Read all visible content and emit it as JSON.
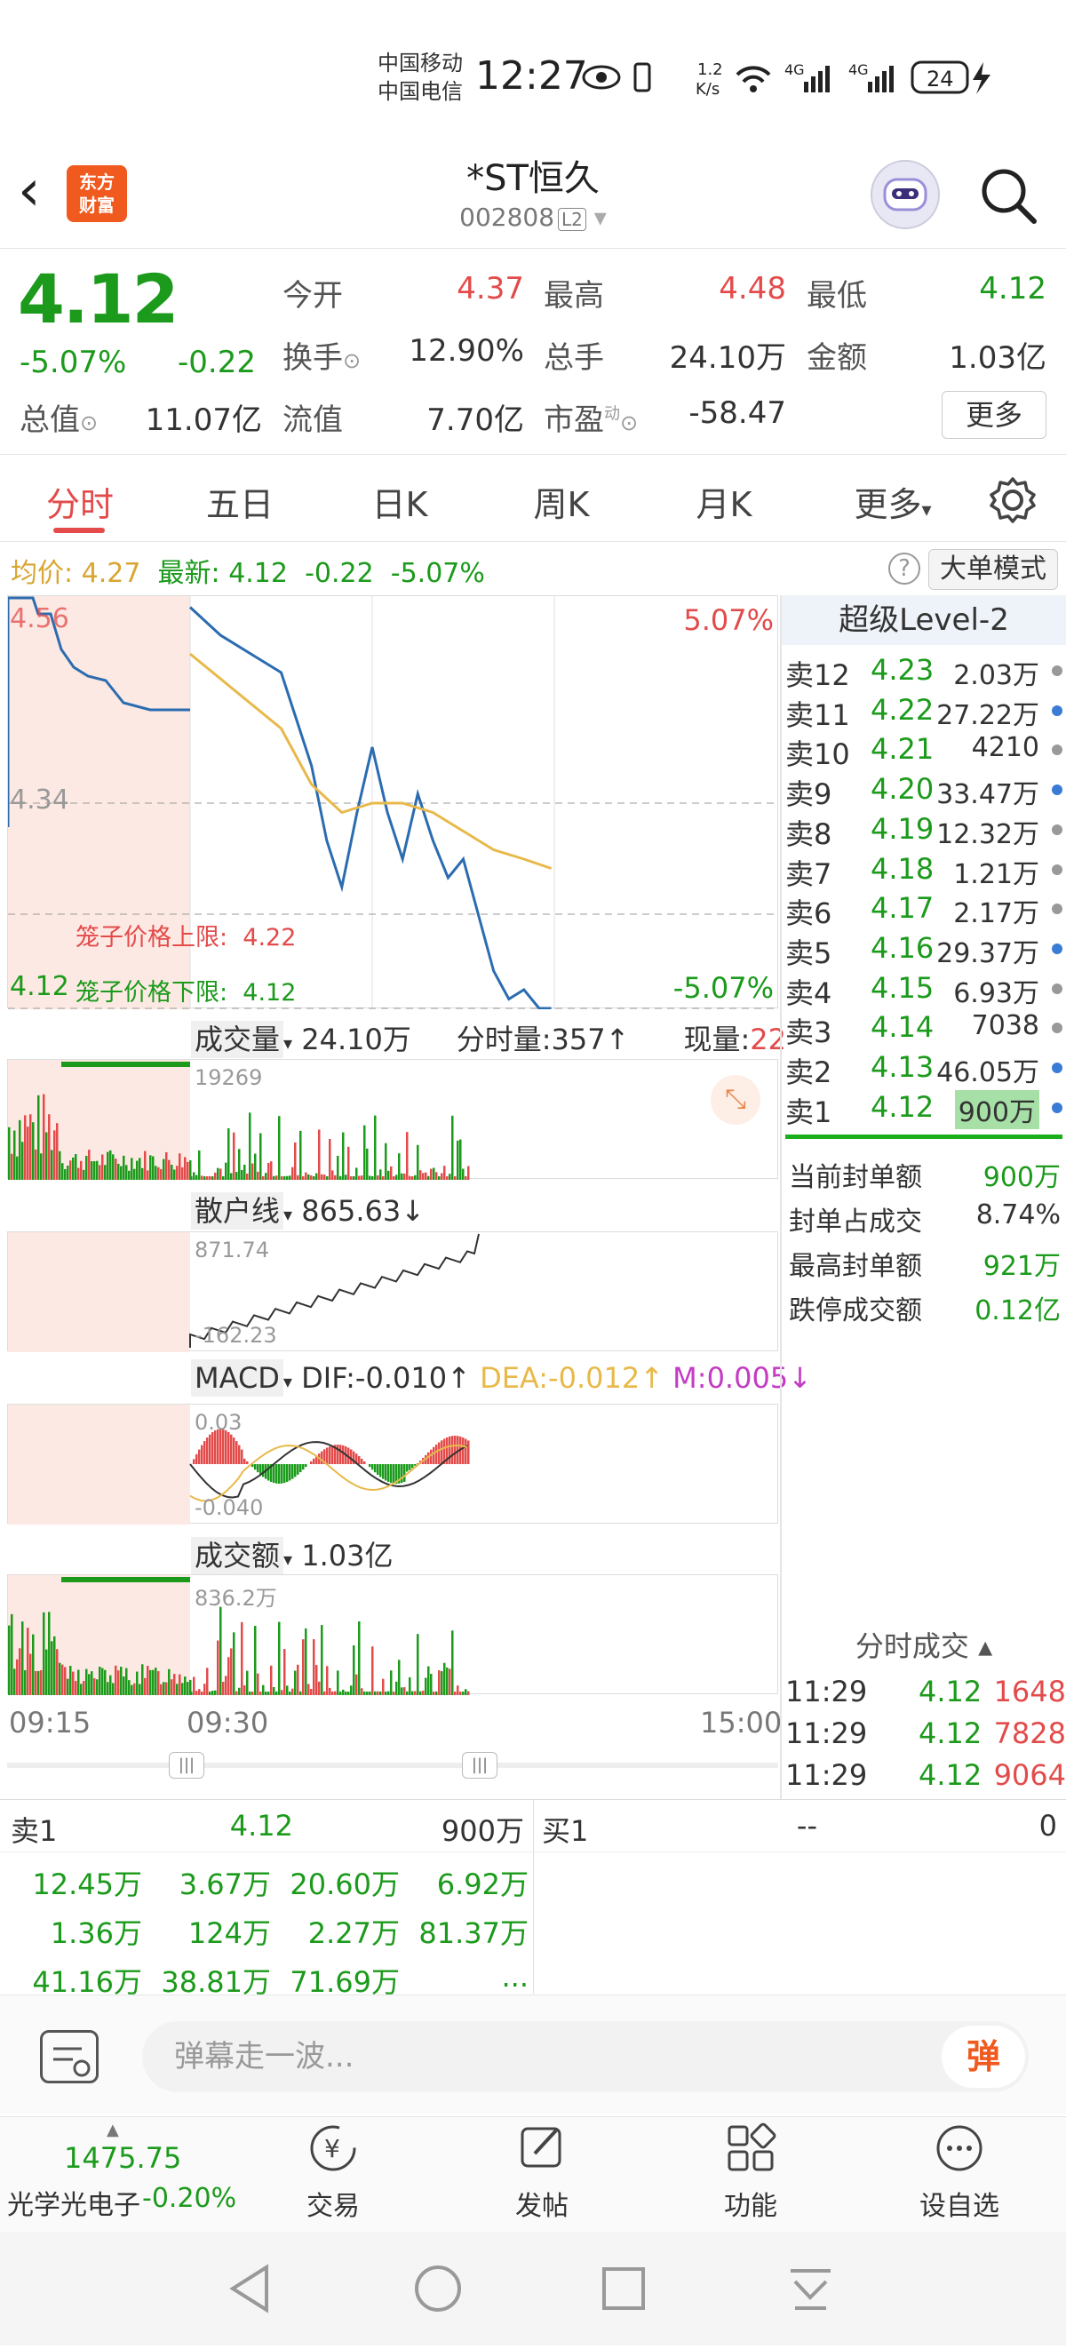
{
  "status_bar": {
    "carrier1": "中国移动",
    "carrier2": "中国电信",
    "time": "12:27",
    "speed": "1.2 K/s",
    "battery": "24"
  },
  "header": {
    "title": "*ST恒久",
    "code": "002808",
    "level_badge": "L2",
    "logo_text": "东方财富"
  },
  "quote": {
    "price": "4.12",
    "change_pct": "-5.07%",
    "change": "-0.22",
    "open_label": "今开",
    "open": "4.37",
    "high_label": "最高",
    "high": "4.48",
    "low_label": "最低",
    "low": "4.12",
    "turnover_label": "换手",
    "turnover": "12.90%",
    "volume_label": "总手",
    "volume": "24.10万",
    "amount_label": "金额",
    "amount": "1.03亿",
    "mktcap_label": "总值",
    "mktcap": "11.07亿",
    "float_label": "流值",
    "float": "7.70亿",
    "pe_label": "市盈",
    "pe_sup": "动",
    "pe": "-58.47",
    "more": "更多"
  },
  "tabs": [
    "分时",
    "五日",
    "日K",
    "周K",
    "月K",
    "更多"
  ],
  "avg_bar": {
    "avg_label": "均价:",
    "avg": "4.27",
    "last_label": "最新:",
    "last": "4.12",
    "chg": "-0.22",
    "pct": "-5.07%",
    "bigmode": "大单模式"
  },
  "intraday": {
    "y_top": "4.56",
    "y_mid": "4.34",
    "y_bottom": "4.12",
    "pct_top": "5.07%",
    "pct_bottom": "-5.07%",
    "upper_limit": "笼子价格上限:  4.22",
    "lower_limit": "笼子价格下限:  4.12"
  },
  "volume_panel": {
    "label": "成交量",
    "total": "24.10万",
    "tick_label": "分时量:357↑",
    "now_label": "现量:",
    "now": "22",
    "max": "19269"
  },
  "retail_panel": {
    "label": "散户线",
    "value": "865.63↓",
    "top": "871.74",
    "bottom": "-162.23"
  },
  "macd_panel": {
    "label": "MACD",
    "dif": "DIF:-0.010↑",
    "dea": "DEA:-0.012↑",
    "m": "M:0.005↓",
    "top": "0.03",
    "bottom": "-0.040"
  },
  "amount_panel": {
    "label": "成交额",
    "value": "1.03亿",
    "max": "836.2万"
  },
  "time_axis": {
    "start": "09:15",
    "open": "09:30",
    "end": "15:00"
  },
  "level2": {
    "title": "超级Level-2",
    "asks": [
      {
        "name": "卖12",
        "price": "4.23",
        "vol": "2.03万"
      },
      {
        "name": "卖11",
        "price": "4.22",
        "vol": "27.22万"
      },
      {
        "name": "卖10",
        "price": "4.21",
        "vol": "4210"
      },
      {
        "name": "卖9",
        "price": "4.20",
        "vol": "33.47万"
      },
      {
        "name": "卖8",
        "price": "4.19",
        "vol": "12.32万"
      },
      {
        "name": "卖7",
        "price": "4.18",
        "vol": "1.21万"
      },
      {
        "name": "卖6",
        "price": "4.17",
        "vol": "2.17万"
      },
      {
        "name": "卖5",
        "price": "4.16",
        "vol": "29.37万"
      },
      {
        "name": "卖4",
        "price": "4.15",
        "vol": "6.93万"
      },
      {
        "name": "卖3",
        "price": "4.14",
        "vol": "7038"
      },
      {
        "name": "卖2",
        "price": "4.13",
        "vol": "46.05万"
      },
      {
        "name": "卖1",
        "price": "4.12",
        "vol": "900万"
      }
    ],
    "seal": [
      {
        "label": "当前封单额",
        "value": "900万"
      },
      {
        "label": "封单占成交",
        "value": "8.74%"
      },
      {
        "label": "最高封单额",
        "value": "921万"
      },
      {
        "label": "跌停成交额",
        "value": "0.12亿"
      }
    ],
    "trades_title": "分时成交",
    "trades": [
      {
        "time": "11:29",
        "price": "4.12",
        "vol": "1648"
      },
      {
        "time": "11:29",
        "price": "4.12",
        "vol": "7828"
      },
      {
        "time": "11:29",
        "price": "4.12",
        "vol": "9064"
      }
    ]
  },
  "book": {
    "sell_label": "卖1",
    "sell_price": "4.12",
    "sell_vol": "900万",
    "buy_label": "买1",
    "buy_price": "--",
    "buy_vol": "0",
    "queue": [
      "12.45万",
      "3.67万",
      "20.60万",
      "6.92万",
      "1.36万",
      "124万",
      "2.27万",
      "81.37万",
      "41.16万",
      "38.81万",
      "71.69万",
      "..."
    ]
  },
  "danmu": {
    "placeholder": "弹幕走一波...",
    "button": "弹"
  },
  "nav": {
    "index_value": "1475.75",
    "index_name": "光学光电子",
    "index_pct": "-0.20%",
    "items": [
      "交易",
      "发帖",
      "功能",
      "设自选"
    ]
  },
  "chart_data": {
    "type": "line",
    "title": "",
    "xlabel": "",
    "ylabel": "",
    "x_ticks": [
      "09:15",
      "09:30",
      "15:00"
    ],
    "ylim": [
      4.12,
      4.56
    ],
    "series": [
      {
        "name": "最新",
        "color": "#2b6cb0",
        "x": [
          "09:30",
          "09:40",
          "09:50",
          "10:00",
          "10:05",
          "10:10",
          "10:15",
          "10:20",
          "10:25",
          "10:30",
          "10:35",
          "10:40",
          "10:45",
          "10:50",
          "10:55",
          "11:00",
          "11:05",
          "11:10",
          "11:15",
          "11:20",
          "11:25",
          "11:29"
        ],
        "values": [
          4.55,
          4.52,
          4.5,
          4.48,
          4.43,
          4.38,
          4.3,
          4.25,
          4.33,
          4.4,
          4.33,
          4.28,
          4.35,
          4.3,
          4.26,
          4.28,
          4.22,
          4.16,
          4.13,
          4.14,
          4.12,
          4.12
        ]
      },
      {
        "name": "均价",
        "color": "#e8b94a",
        "x": [
          "09:30",
          "10:00",
          "10:10",
          "10:20",
          "10:30",
          "10:40",
          "10:50",
          "11:00",
          "11:10",
          "11:20",
          "11:29"
        ],
        "values": [
          4.5,
          4.42,
          4.36,
          4.33,
          4.34,
          4.34,
          4.33,
          4.31,
          4.29,
          4.28,
          4.27
        ]
      }
    ]
  }
}
